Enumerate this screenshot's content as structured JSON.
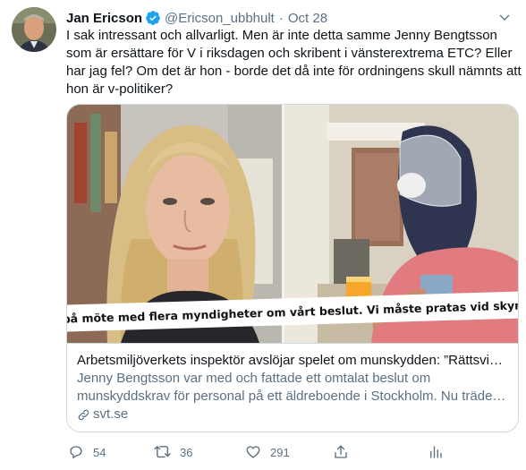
{
  "tweet": {
    "author_name": "Jan Ericson",
    "handle": "@Ericson_ubbhult",
    "separator": "·",
    "date": "Oct 28",
    "verified": true,
    "text": "I sak intressant och allvarligt. Men är inte detta samme Jenny Bengtsson som är ersättare för V i riksdagen och skribent i vänsterextrema ETC? Eller har jag fel? Om det är hon - borde det då inte för ordningens skull nämnts att hon är v-politiker?"
  },
  "card": {
    "image_caption": "Sitter på möte med flera myndigheter om vårt beslut. Vi måste pratas vid skyndsamt.",
    "title": "Arbetsmiljöverkets inspektör avslöjar spelet om munskydden: ”Rättsvidrigt”",
    "description": "Jenny Bengtsson var med och fattade ett omtalat beslut om munskyddskrav för personal på ett äldreboende i Stockholm. Nu träder hon fram.",
    "domain": "svt.se"
  },
  "actions": {
    "reply_count": "54",
    "retweet_count": "36",
    "like_count": "291"
  },
  "icons": {
    "verified": "verified-badge-icon",
    "caret": "chevron-down-icon",
    "reply": "reply-icon",
    "retweet": "retweet-icon",
    "like": "heart-icon",
    "share": "share-icon",
    "analytics": "analytics-icon",
    "link": "link-icon"
  },
  "colors": {
    "accent": "#1da1f2",
    "secondary_text": "#5b7083",
    "primary_text": "#0f1419",
    "border": "#cfd9de"
  }
}
